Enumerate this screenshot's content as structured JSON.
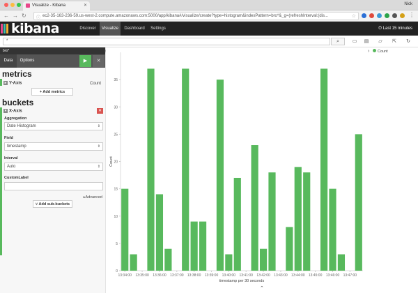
{
  "browser": {
    "tab_title": "Visualize - Kibana",
    "user_name": "Nick",
    "url": "ec2-35-163-236-59.us-west-2.compute.amazonaws.com:5000/app/kibana#/visualize/create?type=histogram&indexPattern=bro*&_g=(refreshInterval:(dis..."
  },
  "kibana": {
    "logo_text": "kibana",
    "nav": [
      "Discover",
      "Visualize",
      "Dashboard",
      "Settings"
    ],
    "active_nav": "Visualize",
    "time_range": "Last 15 minutes",
    "query_value": "*"
  },
  "sidebar": {
    "index_pattern": "bro*",
    "tabs": [
      "Data",
      "Options"
    ],
    "metrics_title": "metrics",
    "y_axis_label": "Y-Axis",
    "y_axis_value": "Count",
    "add_metrics": "Add metrics",
    "buckets_title": "buckets",
    "x_axis_label": "X-Axis",
    "aggregation_label": "Aggregation",
    "aggregation_value": "Date Histogram",
    "field_label": "Field",
    "field_value": "timestamp",
    "interval_label": "Interval",
    "interval_value": "Auto",
    "custom_label": "CustomLabel",
    "custom_value": "",
    "advanced": "Advanced",
    "add_sub_buckets": "Add sub-buckets"
  },
  "chart_data": {
    "type": "bar",
    "title": "",
    "xlabel": "timestamp per 30 seconds",
    "ylabel": "Count",
    "ylim": [
      0,
      40
    ],
    "yticks": [
      0,
      5,
      10,
      15,
      20,
      25,
      30,
      35
    ],
    "legend": [
      {
        "name": "Count",
        "color": "#58b95d"
      }
    ],
    "legend_position": "top-right",
    "categories": [
      "13:34:00",
      "13:34:30",
      "13:35:00",
      "13:35:30",
      "13:36:00",
      "13:36:30",
      "13:37:00",
      "13:37:30",
      "13:38:00",
      "13:38:30",
      "13:39:00",
      "13:39:30",
      "13:40:00",
      "13:40:30",
      "13:41:00",
      "13:41:30",
      "13:42:00",
      "13:42:30",
      "13:43:00",
      "13:43:30",
      "13:44:00",
      "13:44:30",
      "13:45:00",
      "13:45:30",
      "13:46:00",
      "13:46:30",
      "13:47:00",
      "13:47:30"
    ],
    "values": [
      15,
      3,
      0,
      37,
      14,
      4,
      0,
      37,
      9,
      9,
      0,
      35,
      3,
      17,
      0,
      23,
      4,
      18,
      0,
      8,
      19,
      18,
      0,
      37,
      15,
      3,
      0,
      25
    ],
    "xticks": [
      "13:34:00",
      "13:35:00",
      "13:36:00",
      "13:37:00",
      "13:38:00",
      "13:39:00",
      "13:40:00",
      "13:41:00",
      "13:42:00",
      "13:43:00",
      "13:44:00",
      "13:45:00",
      "13:46:00",
      "13:47:00"
    ],
    "color": "#58b95d"
  }
}
